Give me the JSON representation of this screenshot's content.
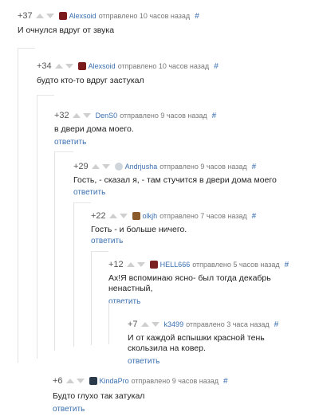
{
  "comments": [
    {
      "score": "+37",
      "user": "Alexsoid",
      "time": "отправлено 10 часов назад",
      "hash": "#",
      "text": "И очнулся вдруг от звука",
      "reply": "",
      "avatar_color": "#7a1a1a"
    },
    {
      "score": "+34",
      "user": "Alexsoid",
      "time": "отправлено 10 часов назад",
      "hash": "#",
      "text": "будто кто-то вдруг застукал",
      "reply": "",
      "avatar_color": "#7a1a1a"
    },
    {
      "score": "+32",
      "user": "DenS0",
      "time": "отправлено 9 часов назад",
      "hash": "#",
      "text": "в двери дома моего.",
      "reply": "ответить",
      "avatar_color": ""
    },
    {
      "score": "+29",
      "user": "Andrjusha",
      "time": "отправлено 9 часов назад",
      "hash": "#",
      "text": "Гость, - сказал я, - там стучится в двери дома моего",
      "reply": "ответить",
      "avatar_color": "#cfd6db"
    },
    {
      "score": "+22",
      "user": "olkjh",
      "time": "отправлено 7 часов назад",
      "hash": "#",
      "text": "Гость - и больше ничего.",
      "reply": "ответить",
      "avatar_color": "#8a5a2a"
    },
    {
      "score": "+12",
      "user": "HELL666",
      "time": "отправлено 5 часов назад",
      "hash": "#",
      "text": "Ах!Я вспоминаю ясно- был тогда декабрь",
      "text2": "ненастный,",
      "reply": "ответить",
      "avatar_color": "#7a2020"
    },
    {
      "score": "+7",
      "user": "k3499",
      "time": "отправлено 3 часа назад",
      "hash": "#",
      "text": "И от каждой вспышки красной тень",
      "text2": "скользила на ковер.",
      "reply": "ответить",
      "avatar_color": ""
    },
    {
      "score": "+6",
      "user": "KindaPro",
      "time": "отправлено 9 часов назад",
      "hash": "#",
      "text": "Будто глухо так затукал",
      "reply": "ответить",
      "avatar_color": "#2a3a4a"
    }
  ]
}
